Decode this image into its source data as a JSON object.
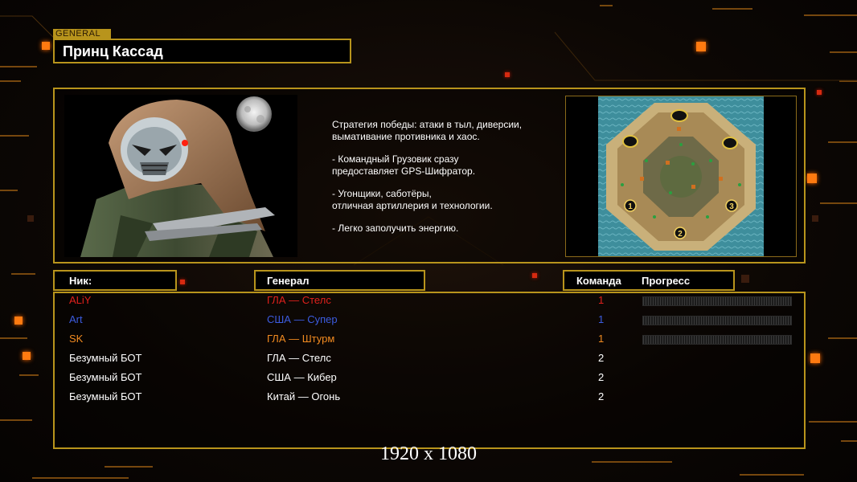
{
  "header": {
    "tag": "GENERAL",
    "general_name": "Принц Кассад"
  },
  "description": [
    "Стратегия победы: атаки в тыл, диверсии,\n вымативание противника и хаос.",
    "- Командный Грузовик сразу\nпредоставляет GPS-Шифратор.",
    "- Угонщики, саботёры,\nотличная артиллерия и технологии.",
    "- Легко заполучить энергию."
  ],
  "minimap": {
    "start_positions": [
      "1",
      "2",
      "3"
    ]
  },
  "table": {
    "headers": {
      "nick": "Ник:",
      "general": "Генерал",
      "team": "Команда",
      "progress": "Прогресс"
    },
    "rows": [
      {
        "nick": "ALiY",
        "general": "ГЛА — Стелс",
        "team": "1",
        "color": "#e0201c",
        "progress": true
      },
      {
        "nick": "Art",
        "general": "США — Супер",
        "team": "1",
        "color": "#3c5ce0",
        "progress": true
      },
      {
        "nick": "SK",
        "general": "ГЛА — Штурм",
        "team": "1",
        "color": "#f08a20",
        "progress": true
      },
      {
        "nick": "Безумный БОТ",
        "general": "ГЛА — Стелс",
        "team": "2",
        "color": "#ffffff",
        "progress": false
      },
      {
        "nick": "Безумный БОТ",
        "general": "США — Кибер",
        "team": "2",
        "color": "#ffffff",
        "progress": false
      },
      {
        "nick": "Безумный БОТ",
        "general": "Китай — Огонь",
        "team": "2",
        "color": "#ffffff",
        "progress": false
      }
    ]
  },
  "resolution_label": "1920 x 1080",
  "colors": {
    "accent_gold": "#b8941c",
    "glow_orange": "#ff7a10"
  }
}
